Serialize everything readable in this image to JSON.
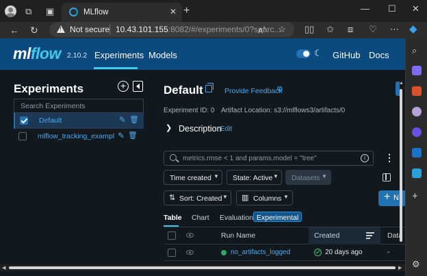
{
  "browser": {
    "tab_title": "MLflow",
    "tab_close": "✕",
    "new_tab": "+",
    "security_label": "Not secure",
    "url_host": "10.43.101.155",
    "url_rest": ":8082/#/experiments/0?searc...",
    "window_controls": [
      "—",
      "☐",
      "✕"
    ]
  },
  "header": {
    "logo_ml": "ml",
    "logo_flow": "flow",
    "version": "2.10.2",
    "nav": [
      "Experiments",
      "Models",
      "GitHub",
      "Docs"
    ]
  },
  "sidebar": {
    "title": "Experiments",
    "search_placeholder": "Search Experiments",
    "experiments": [
      {
        "name": "Default",
        "selected": true
      },
      {
        "name": "mlflow_tracking_example",
        "selected": false
      }
    ]
  },
  "experiment": {
    "title": "Default",
    "feedback_link": "Provide Feedback",
    "id_text": "Experiment ID: 0",
    "artifact_text": "Artifact Location: s3://mlflows3/artifacts/0",
    "description_label": "Description",
    "description_edit": "Edit"
  },
  "toolbar": {
    "search_placeholder": "metrics.rmse < 1 and params.model = \"tree\"",
    "time_created": "Time created",
    "state": "State: Active",
    "datasets": "Datasets",
    "sort": "Sort: Created",
    "columns": "Columns",
    "new_run_partial": "N"
  },
  "view_tabs": [
    "Table",
    "Chart",
    "Evaluation",
    "Experimental"
  ],
  "table": {
    "headers": [
      "Run Name",
      "Created",
      "Data"
    ],
    "rows": [
      {
        "run_name": "no_artifacts_logged",
        "created": "20 days ago",
        "dataset": "-"
      }
    ]
  },
  "colors": {
    "header_bg": "#0a4a7f",
    "app_bg": "#11191f",
    "accent": "#2272b4",
    "link": "#4ea8ec",
    "logo_flow": "#43c9ed",
    "status_ok": "#2ea66a"
  }
}
